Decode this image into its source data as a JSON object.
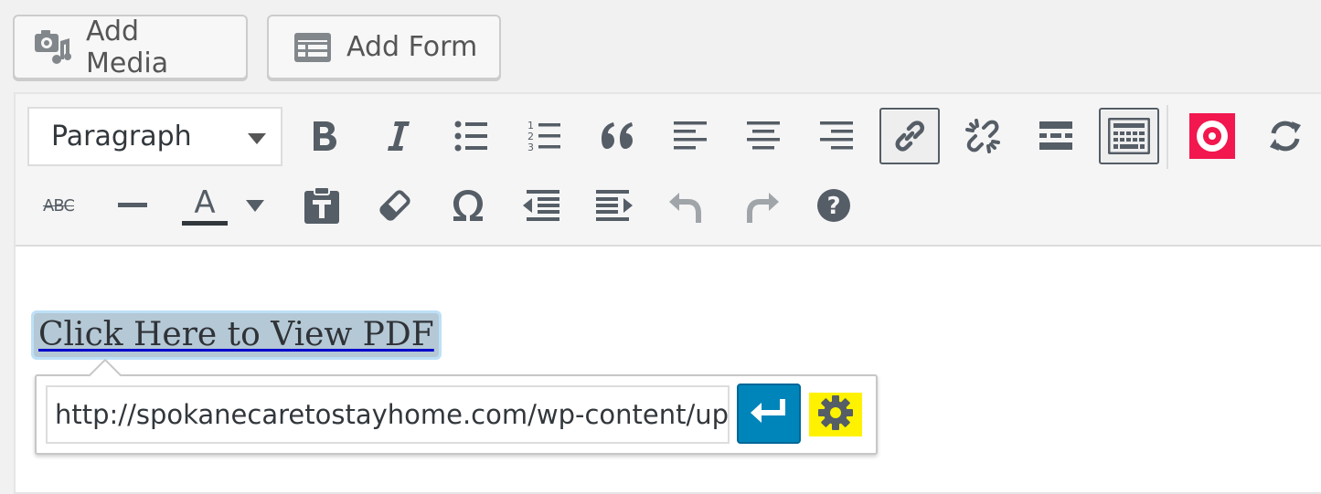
{
  "top_buttons": {
    "add_media_label": "Add Media",
    "add_form_label": "Add Form"
  },
  "toolbar": {
    "format_select_value": "Paragraph",
    "row1_icons": [
      "bold-icon",
      "italic-icon",
      "bulleted-list-icon",
      "numbered-list-icon",
      "blockquote-icon",
      "align-left-icon",
      "align-center-icon",
      "align-right-icon",
      "insert-link-icon",
      "remove-link-icon",
      "read-more-icon",
      "toolbar-toggle-icon",
      "plugin-logo-icon",
      "refresh-icon"
    ],
    "row2_icons": [
      "strikethrough-icon",
      "horizontal-line-icon",
      "text-color-icon",
      "text-color-dropdown-icon",
      "paste-as-text-icon",
      "clear-formatting-icon",
      "special-character-icon",
      "outdent-icon",
      "indent-icon",
      "undo-icon",
      "redo-icon",
      "help-icon"
    ],
    "strikethrough_glyph": "ABC",
    "text_color_glyph": "A",
    "accent_color": "#0085ba",
    "icon_color": "#555d66",
    "disabled_icon_color": "#a0a5aa"
  },
  "content": {
    "link_text": "Click Here to View PDF"
  },
  "link_popover": {
    "url_value": "http://spokanecaretostayhome.com/wp-content/uploads/",
    "highlight_color": "#fff200"
  }
}
